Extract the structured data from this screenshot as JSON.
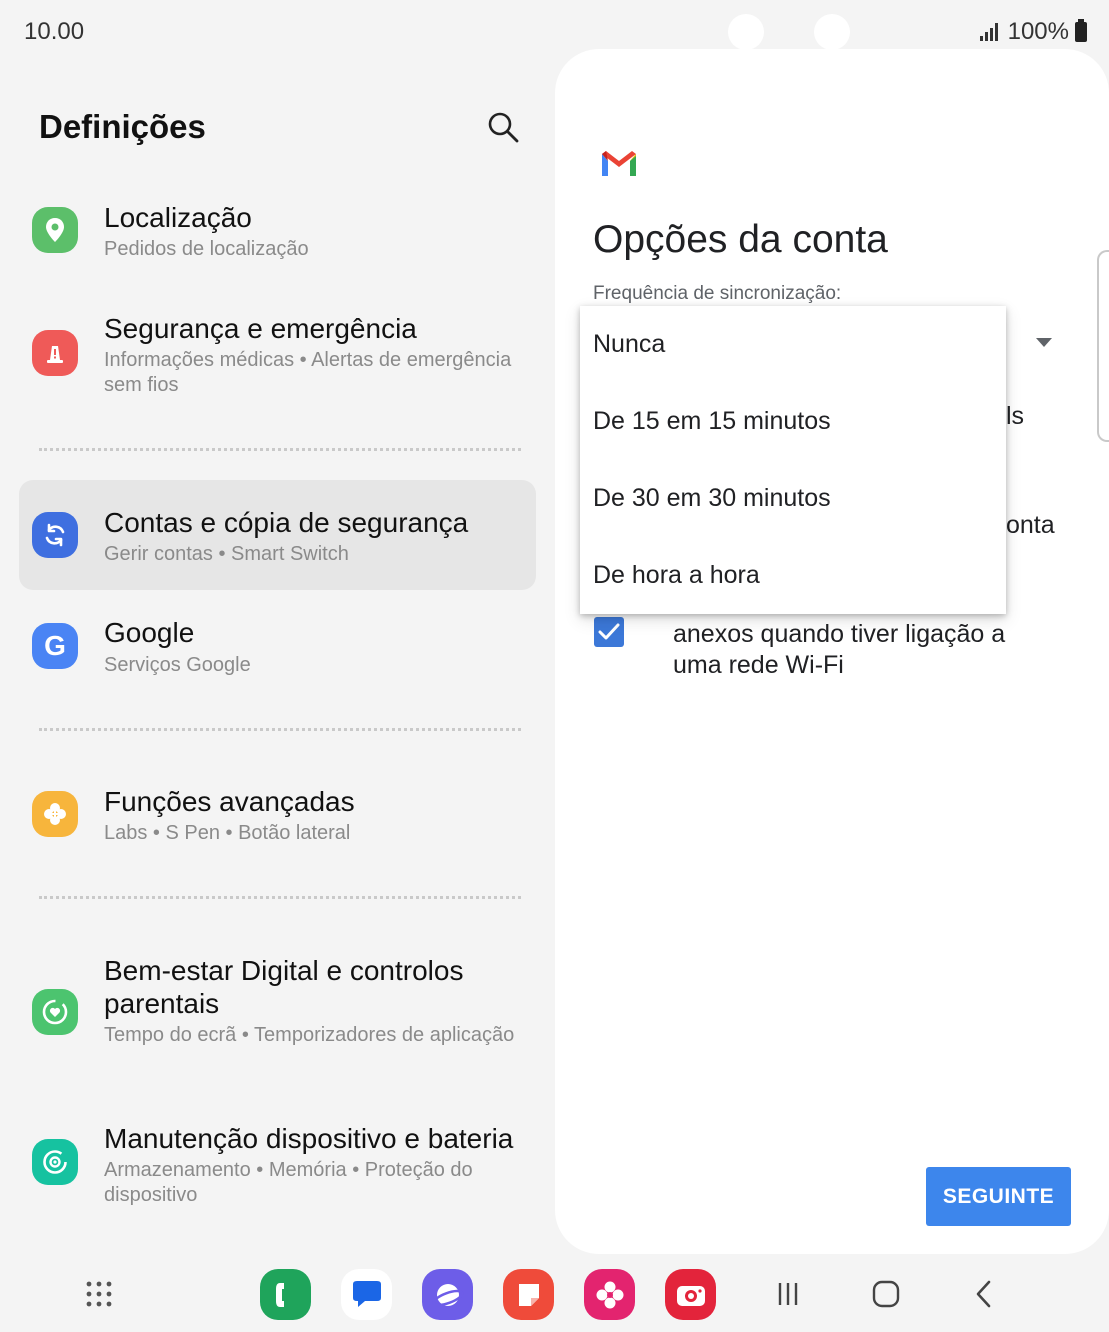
{
  "status_bar": {
    "time": "10.00",
    "battery": "100%"
  },
  "settings": {
    "title": "Definições",
    "items": [
      {
        "title": "Localização",
        "subtitle": "Pedidos de localização",
        "icon": "location-pin-icon",
        "color": "#5cbf6a"
      },
      {
        "title": "Segurança e emergência",
        "subtitle": "Informações médicas  •  Alertas de emergência sem fios",
        "icon": "safety-alert-icon",
        "color": "#ef5a58"
      },
      {
        "title": "Contas e cópia de segurança",
        "subtitle": "Gerir contas  •  Smart Switch",
        "icon": "sync-icon",
        "color": "#3f6fe0"
      },
      {
        "title": "Google",
        "subtitle": "Serviços Google",
        "icon": "google-g-icon",
        "color": "#4a84f4"
      },
      {
        "title": "Funções avançadas",
        "subtitle": "Labs  •  S Pen  •  Botão lateral",
        "icon": "advanced-features-icon",
        "color": "#f7b53c"
      },
      {
        "title": "Bem-estar Digital e controlos parentais",
        "subtitle": "Tempo do ecrã  •  Temporizadores de aplicação",
        "icon": "wellbeing-icon",
        "color": "#4cc46f"
      },
      {
        "title": "Manutenção dispositivo e bateria",
        "subtitle": "Armazenamento  •  Memória  •  Proteção do dispositivo",
        "icon": "device-care-icon",
        "color": "#16c2a0"
      }
    ]
  },
  "account_options": {
    "title": "Opções da conta",
    "sync_label": "Frequência de sincronização:",
    "sync_options": [
      "Nunca",
      "De 15 em 15 minutos",
      "De 30 em 30 minutos",
      "De hora a hora"
    ],
    "partial_text_1": "ls",
    "partial_text_2": "onta",
    "wifi_checkbox_checked": true,
    "wifi_text": "anexos quando tiver ligação a uma rede Wi-Fi",
    "next_label": "SEGUINTE"
  },
  "nav_bar": {
    "dock_apps": [
      "phone-app-icon",
      "messages-app-icon",
      "internet-app-icon",
      "notes-app-icon",
      "gallery-app-icon",
      "camera-app-icon"
    ]
  },
  "colors": {
    "accent": "#3d86ec",
    "panel_bg": "#ffffff",
    "page_bg": "#f4f4f4"
  }
}
